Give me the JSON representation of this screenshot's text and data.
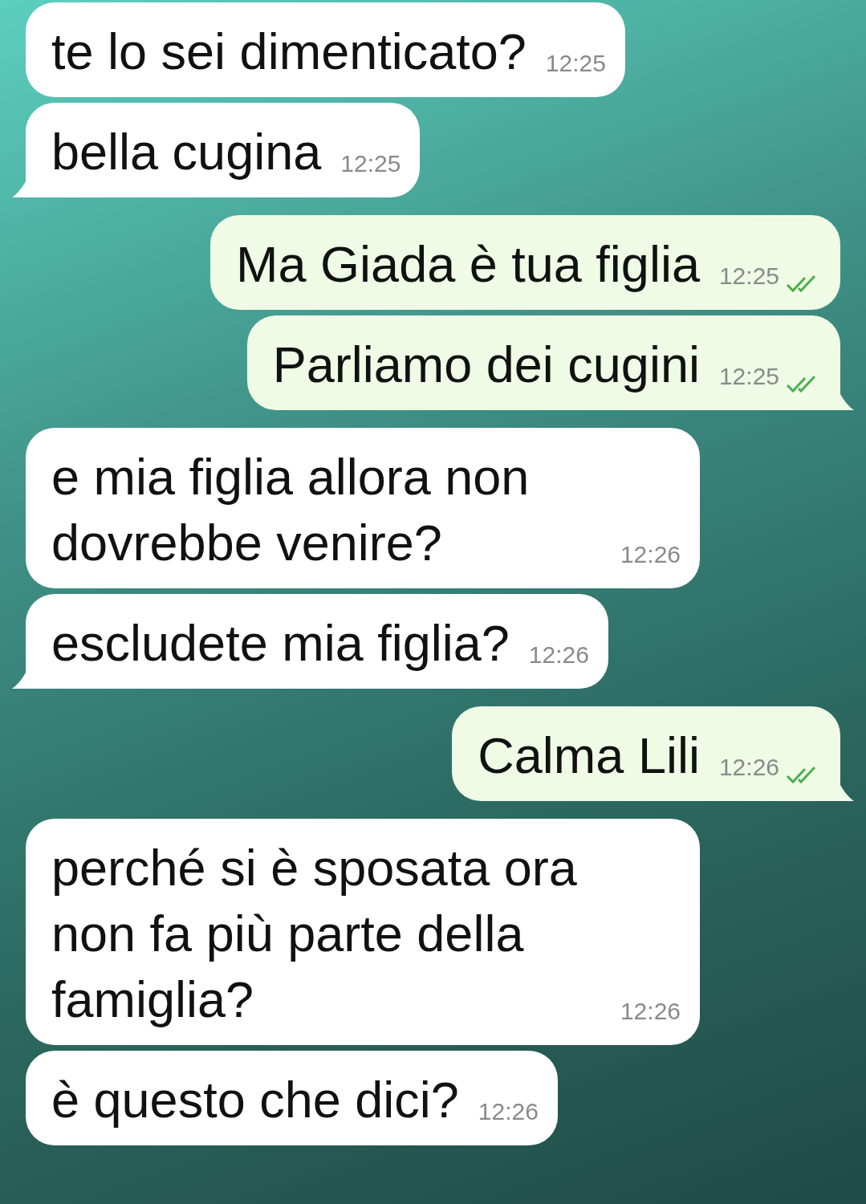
{
  "messages": [
    {
      "outgoing": false,
      "text": "te lo sei dimenticato?",
      "time": "12:25",
      "tail": false
    },
    {
      "outgoing": false,
      "text": "bella cugina",
      "time": "12:25",
      "tail": true
    },
    {
      "outgoing": true,
      "text": "Ma Giada è tua figlia",
      "time": "12:25",
      "tail": false,
      "read": true
    },
    {
      "outgoing": true,
      "text": "Parliamo dei cugini",
      "time": "12:25",
      "tail": true,
      "read": true
    },
    {
      "outgoing": false,
      "text": "e mia figlia allora non dovrebbe venire?",
      "time": "12:26",
      "tail": false
    },
    {
      "outgoing": false,
      "text": "escludete mia figlia?",
      "time": "12:26",
      "tail": true
    },
    {
      "outgoing": true,
      "text": "Calma Lili",
      "time": "12:26",
      "tail": true,
      "read": true
    },
    {
      "outgoing": false,
      "text": "perché si è sposata ora non fa più parte della famiglia?",
      "time": "12:26",
      "tail": false
    },
    {
      "outgoing": false,
      "text": "è questo che dici?",
      "time": "12:26",
      "tail": false
    }
  ]
}
